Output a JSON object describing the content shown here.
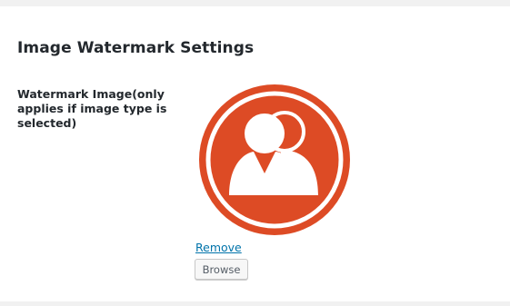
{
  "section": {
    "title": "Image Watermark Settings"
  },
  "watermark_field": {
    "label": "Watermark Image(only applies if image type is selected)",
    "preview_icon": "users-group-icon",
    "preview_color": "#dd4b25",
    "remove_label": "Remove",
    "browse_label": "Browse"
  }
}
